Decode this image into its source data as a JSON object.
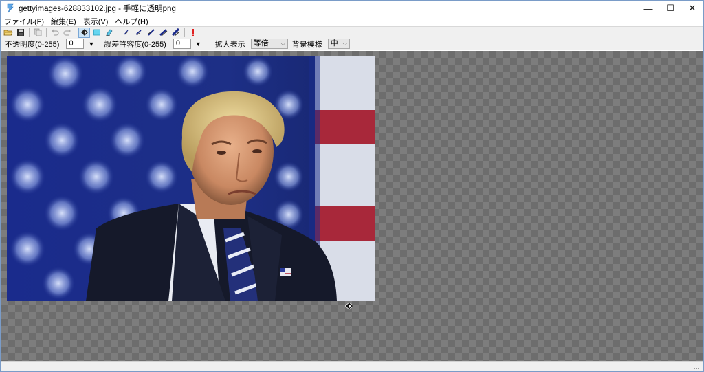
{
  "window": {
    "title": "gettyimages-628833102.jpg - 手軽に透明png",
    "controls": {
      "minimize": "—",
      "maximize": "☐",
      "close": "✕"
    }
  },
  "menu": [
    {
      "label": "ファイル(F)"
    },
    {
      "label": "編集(E)"
    },
    {
      "label": "表示(V)"
    },
    {
      "label": "ヘルプ(H)"
    }
  ],
  "toolbar": {
    "icons": [
      "open-folder-icon",
      "save-icon",
      "copy-icon",
      "undo-icon",
      "redo-icon",
      "fill-transparent-icon",
      "rect-select-icon",
      "eraser-icon",
      "pen-1-icon",
      "pen-2-icon",
      "pen-3-icon",
      "pen-4-icon",
      "pen-5-icon",
      "alert-icon"
    ],
    "active": "fill-transparent-icon"
  },
  "options": {
    "opacity_label": "不透明度(0-255)",
    "opacity_value": "0",
    "tolerance_label": "誤差許容度(0-255)",
    "tolerance_value": "0",
    "zoom_label": "拡大表示",
    "zoom_value": "等倍",
    "bg_pattern_label": "背景模様",
    "bg_pattern_value": "中",
    "down_arrow": "▼"
  },
  "colors": {
    "accent": "#7a9cc8",
    "checker_light": "#7d7d7d",
    "checker_dark": "#6d6d6d",
    "alert": "#e02020"
  }
}
